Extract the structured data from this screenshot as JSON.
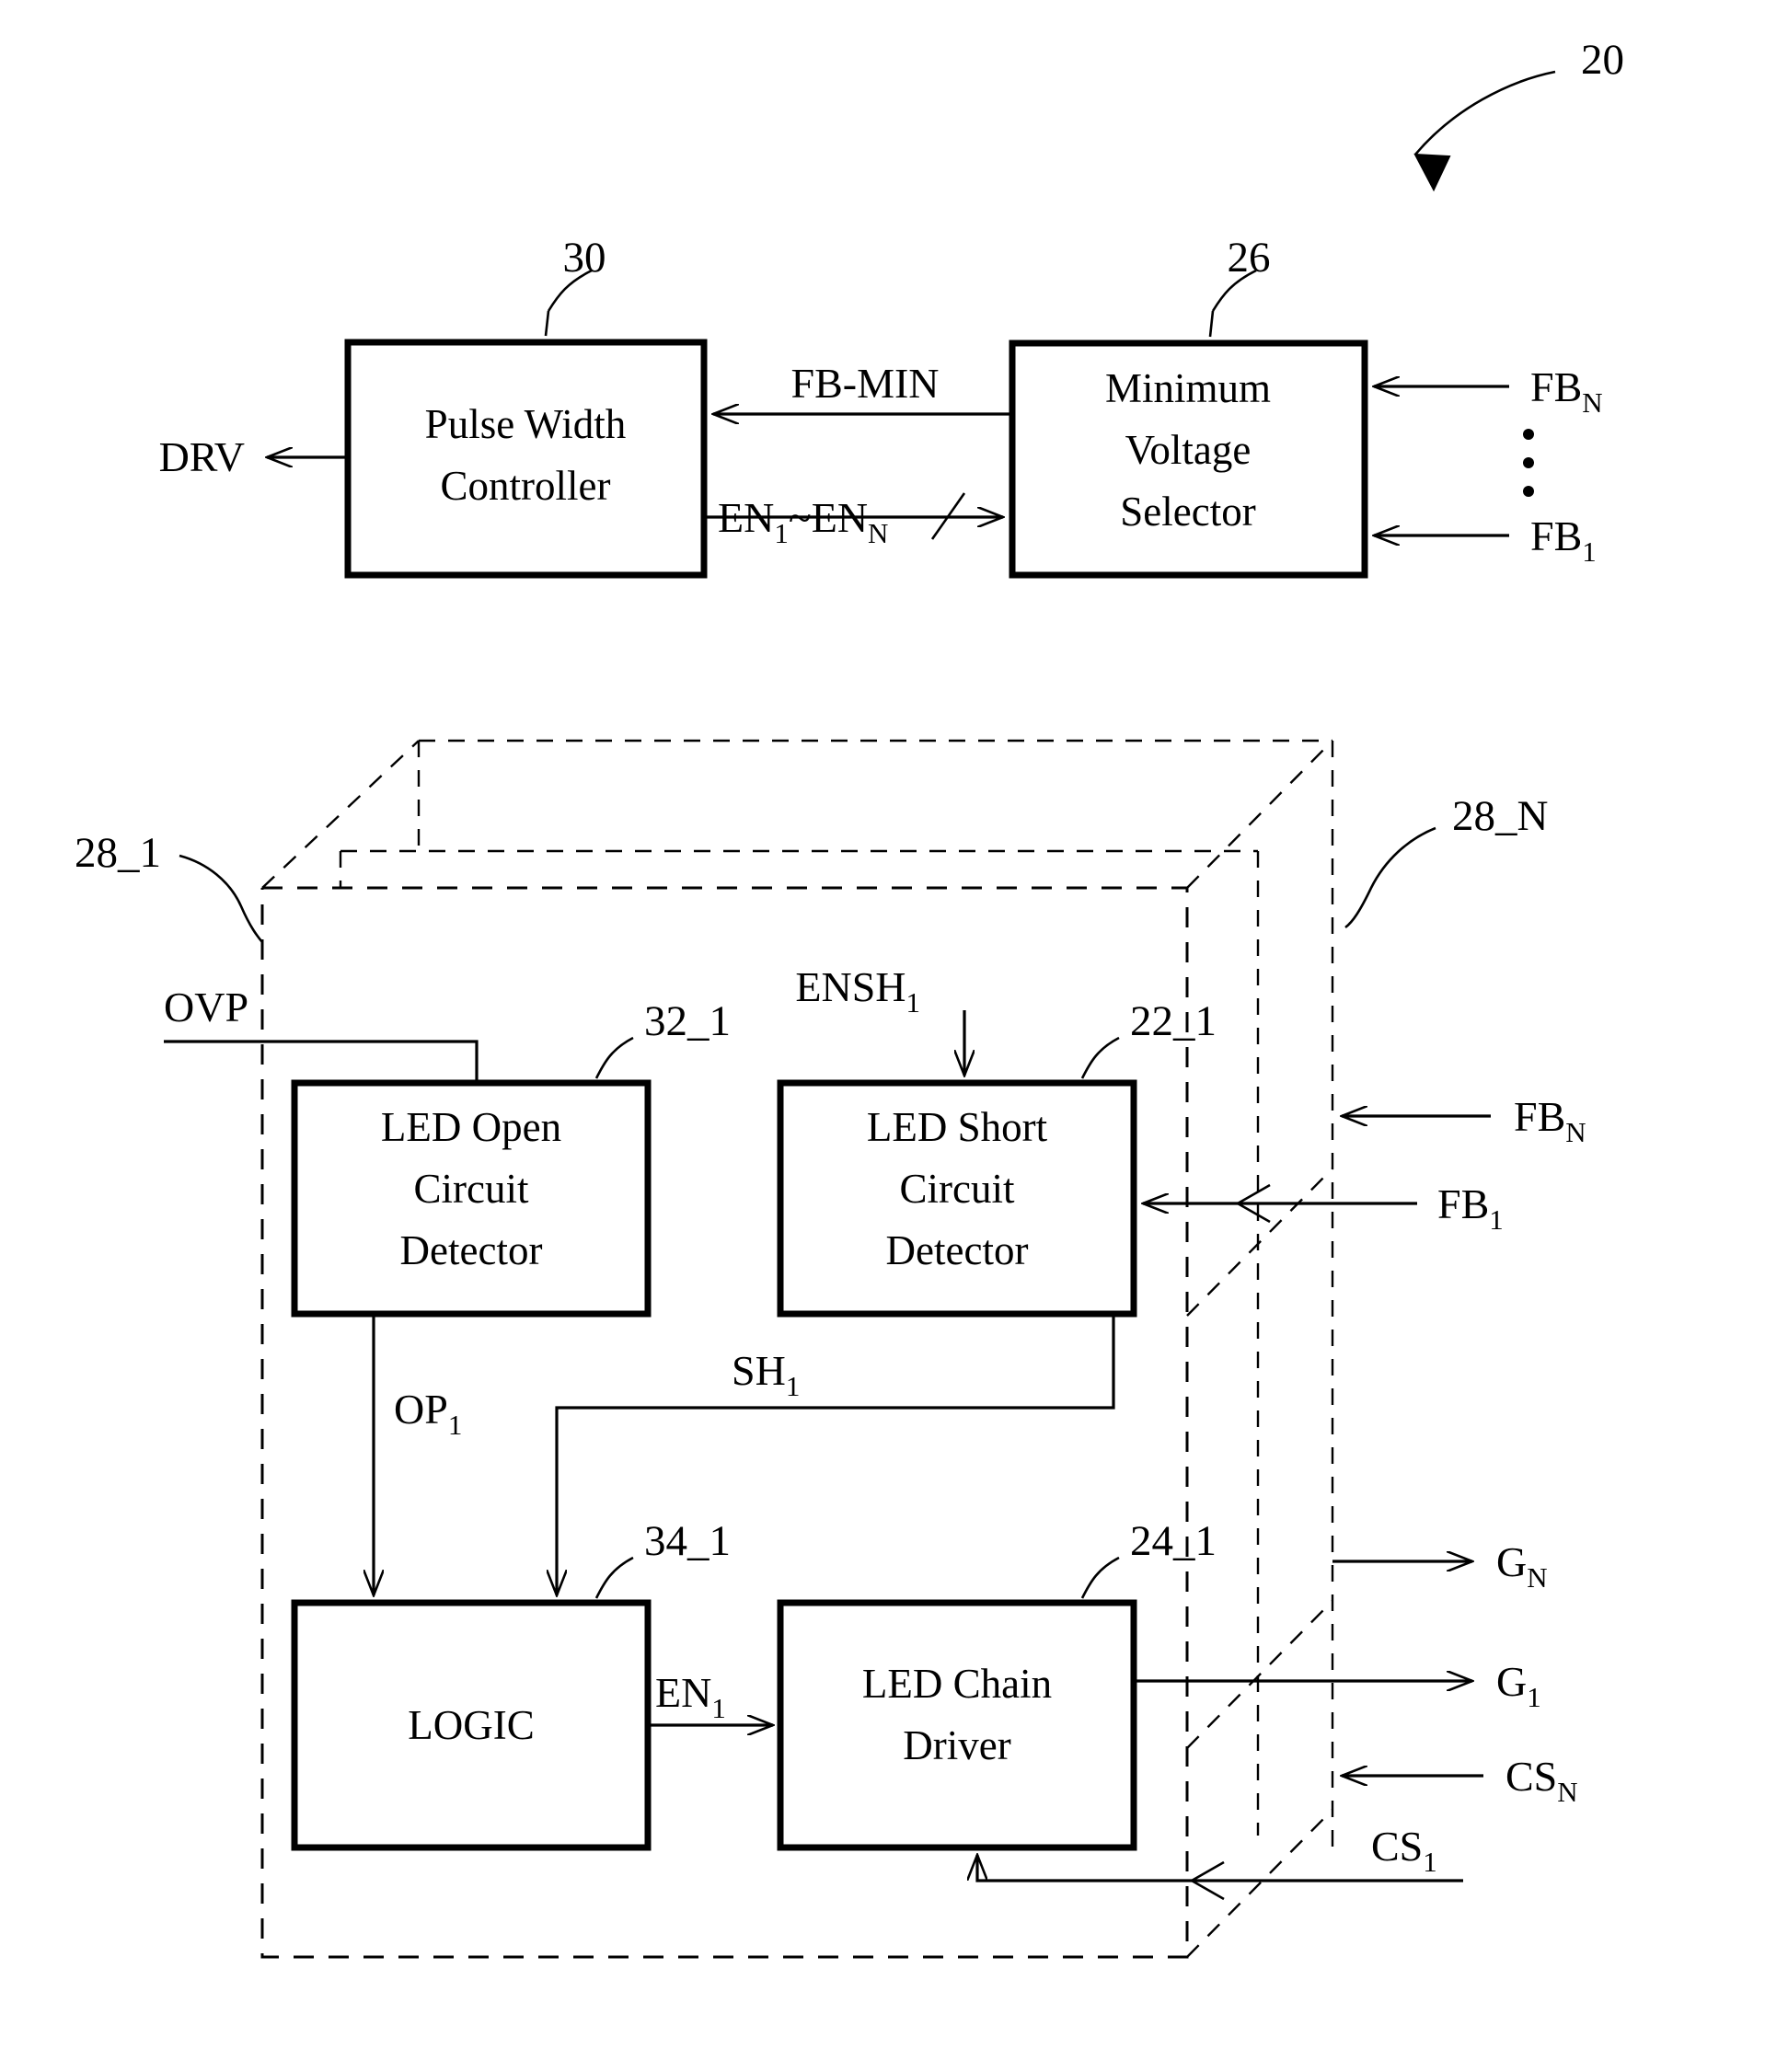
{
  "figure": {
    "overall_ref": "20",
    "top": {
      "pwc": {
        "ref": "30",
        "line1": "Pulse Width",
        "line2": "Controller"
      },
      "mvs": {
        "ref": "26",
        "line1": "Minimum",
        "line2": "Voltage",
        "line3": "Selector"
      },
      "signals": {
        "drv": "DRV",
        "fb_min": "FB-MIN",
        "en_bus_base": "EN",
        "en_bus_sub1": "1",
        "en_bus_mid": "~EN",
        "en_bus_subN": "N",
        "fb_n_base": "FB",
        "fb_n_sub": "N",
        "fb_1_base": "FB",
        "fb_1_sub": "1",
        "vertical_dots": "⋮"
      }
    },
    "bottom": {
      "channel_first_ref": "28_1",
      "channel_last_ref": "28_N",
      "open_detector": {
        "ref": "32_1",
        "line1": "LED Open",
        "line2": "Circuit",
        "line3": "Detector"
      },
      "short_detector": {
        "ref": "22_1",
        "line1": "LED Short",
        "line2": "Circuit",
        "line3": "Detector"
      },
      "logic": {
        "ref": "34_1",
        "label": "LOGIC"
      },
      "chain_driver": {
        "ref": "24_1",
        "line1": "LED Chain",
        "line2": "Driver"
      },
      "signals": {
        "ovp": "OVP",
        "ensh_base": "ENSH",
        "ensh_sub": "1",
        "op_base": "OP",
        "op_sub": "1",
        "sh_base": "SH",
        "sh_sub": "1",
        "en_base": "EN",
        "en_sub": "1",
        "fb_n_base": "FB",
        "fb_n_sub": "N",
        "fb_1_base": "FB",
        "fb_1_sub": "1",
        "g_n_base": "G",
        "g_n_sub": "N",
        "g_1_base": "G",
        "g_1_sub": "1",
        "cs_n_base": "CS",
        "cs_n_sub": "N",
        "cs_1_base": "CS",
        "cs_1_sub": "1"
      }
    }
  },
  "colors": {
    "ink": "#000000",
    "paper": "#ffffff"
  }
}
